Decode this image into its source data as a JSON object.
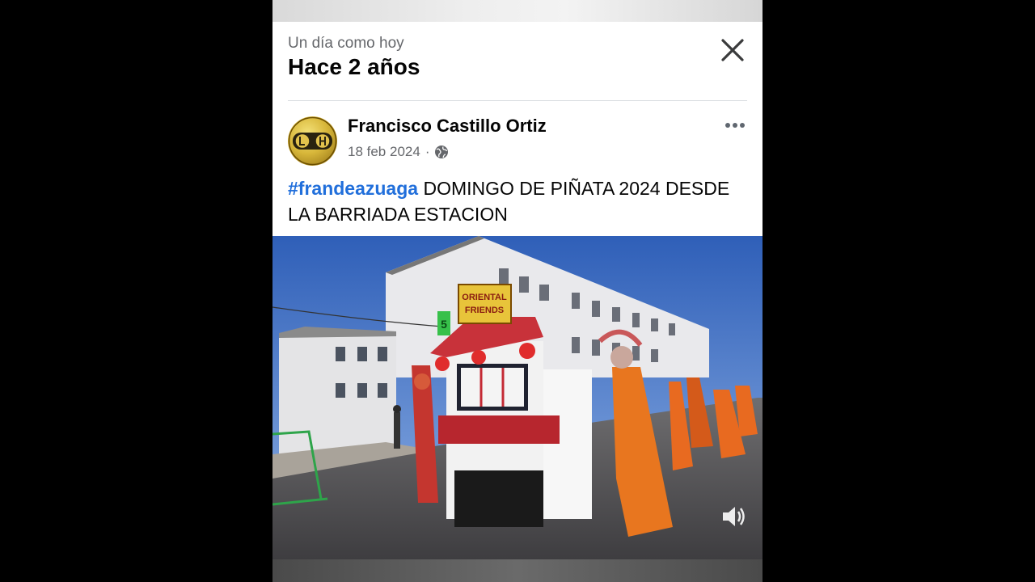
{
  "memory": {
    "subtitle": "Un día como hoy",
    "title": "Hace 2 años"
  },
  "post": {
    "author": "Francisco Castillo Ortiz",
    "date": "18 feb 2024",
    "separator": "·",
    "privacy_icon": "globe-icon",
    "hashtag": "#frandeazuaga",
    "text": " DOMINGO DE PIÑATA 2024 DESDE LA BARRIADA ESTACION"
  },
  "media": {
    "sign_line1": "ORIENTAL",
    "sign_line2": "FRIENDS",
    "float_number": "5",
    "sound_icon": "speaker-icon"
  },
  "colors": {
    "hashtag": "#216fdb",
    "secondary_text": "#65676b",
    "primary_text": "#050505"
  }
}
